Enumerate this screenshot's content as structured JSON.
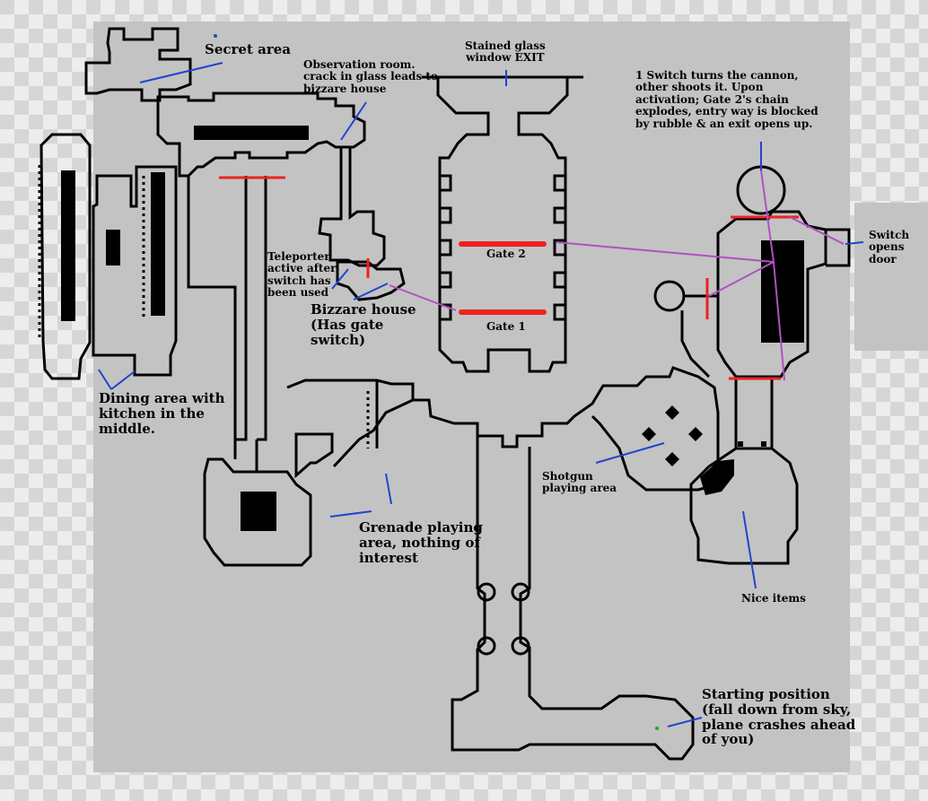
{
  "map": {
    "labels": {
      "secret_area": "Secret area",
      "observation_room": "Observation room.\ncrack in glass leads to\nbizzare house",
      "stained_glass": "Stained glass\nwindow EXIT",
      "cannon_switch": "1 Switch turns the cannon,\nother shoots it. Upon\nactivation; Gate 2's chain\nexplodes, entry way is blocked\nby rubble & an exit opens up.",
      "switch_opens_door": "Switch\nopens\ndoor",
      "teleporter": "Teleporter\nactive after\nswitch has\nbeen used",
      "bizzare_house": "Bizzare house\n(Has gate\nswitch)",
      "gate_2": "Gate 2",
      "gate_1": "Gate 1",
      "dining_area": "Dining area with\nkitchen in the\nmiddle.",
      "grenade_area": "Grenade playing\narea, nothing of\ninterest",
      "shotgun_area": "Shotgun\nplaying area",
      "nice_items": "Nice items",
      "starting_position": "Starting position\n(fall down from sky,\nplane crashes ahead\nof you)"
    },
    "colors": {
      "background_light": "#ededed",
      "background_dark": "#d6d6d6",
      "map_fill": "#c3c3c3",
      "wall": "#000000",
      "annotation_line": "#2244cc",
      "gate": "#ee2222",
      "trigger_line": "#b050c0"
    }
  }
}
